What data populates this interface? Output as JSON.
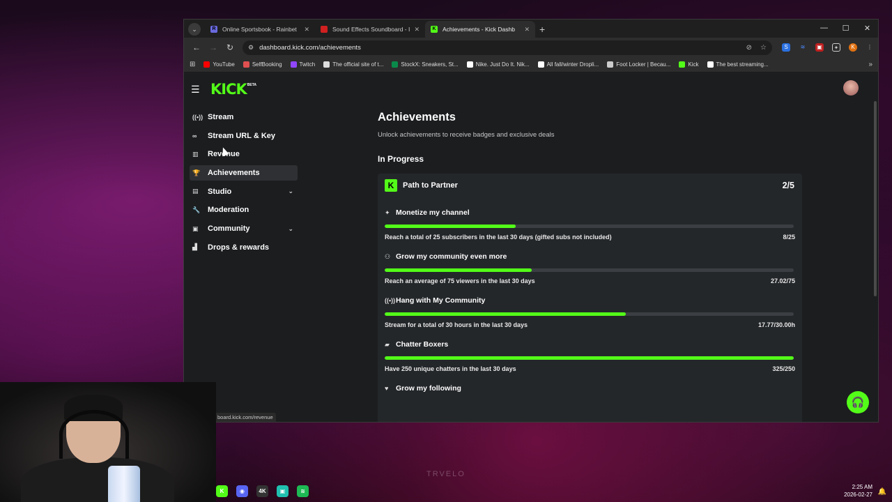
{
  "browser": {
    "tabs": [
      {
        "title": "Online Sportsbook - Rainbet",
        "active": false,
        "favicon_color": "#6a6ae0",
        "glyph": "R"
      },
      {
        "title": "Sound Effects Soundboard - In",
        "active": false,
        "favicon_color": "#d02020",
        "glyph": ""
      },
      {
        "title": "Achievements - Kick Dashb",
        "active": true,
        "favicon_color": "#53fc18",
        "glyph": "K"
      }
    ],
    "new_tab": "+",
    "window_controls": {
      "minimize": "—",
      "maximize": "☐",
      "close": "✕"
    },
    "url": "dashboard.kick.com/achievements",
    "bookmarks": [
      {
        "label": "YouTube",
        "color": "#ff0000"
      },
      {
        "label": "SelfBooking",
        "color": "#e05050"
      },
      {
        "label": "Twitch",
        "color": "#9146ff"
      },
      {
        "label": "The official site of t...",
        "color": "#dddddd"
      },
      {
        "label": "StockX: Sneakers, St...",
        "color": "#0a8a4a"
      },
      {
        "label": "Nike. Just Do It. Nik...",
        "color": "#ffffff"
      },
      {
        "label": "All fall/winter Dropli...",
        "color": "#ffffff"
      },
      {
        "label": "Foot Locker | Becau...",
        "color": "#cccccc"
      },
      {
        "label": "Kick",
        "color": "#53fc18"
      },
      {
        "label": "The best streaming...",
        "color": "#ffffff"
      }
    ],
    "more_bookmarks": "»",
    "status_url": "board.kick.com/revenue"
  },
  "kick": {
    "logo": "KICK",
    "beta": "BETA",
    "sidebar": {
      "items": [
        {
          "label": "Stream",
          "icon": "broadcast-icon",
          "glyph": "((•))",
          "active": false,
          "expandable": false
        },
        {
          "label": "Stream URL & Key",
          "icon": "link-icon",
          "glyph": "∞",
          "active": false,
          "expandable": false
        },
        {
          "label": "Revenue",
          "icon": "chart-icon",
          "glyph": "▥",
          "active": false,
          "expandable": false
        },
        {
          "label": "Achievements",
          "icon": "trophy-icon",
          "glyph": "🏆",
          "active": true,
          "expandable": false
        },
        {
          "label": "Studio",
          "icon": "studio-icon",
          "glyph": "▤",
          "active": false,
          "expandable": true
        },
        {
          "label": "Moderation",
          "icon": "wrench-icon",
          "glyph": "🔧",
          "active": false,
          "expandable": false
        },
        {
          "label": "Community",
          "icon": "community-icon",
          "glyph": "▣",
          "active": false,
          "expandable": true
        },
        {
          "label": "Drops & rewards",
          "icon": "gift-icon",
          "glyph": "▟",
          "active": false,
          "expandable": false
        }
      ]
    },
    "main": {
      "title": "Achievements",
      "subtitle": "Unlock achievements to receive badges and exclusive deals",
      "section": "In Progress",
      "card": {
        "logo": "K",
        "title": "Path to Partner",
        "count": "2/5",
        "achievements": [
          {
            "name": "Monetize my channel",
            "icon": "sparkle-icon",
            "glyph": "✦",
            "desc": "Reach a total of 25 subscribers in the last 30 days (gifted subs not included)",
            "progress_text": "8/25",
            "progress": 0.32
          },
          {
            "name": "Grow my community even more",
            "icon": "people-icon",
            "glyph": "⚇",
            "desc": "Reach an average of 75 viewers in the last 30 days",
            "progress_text": "27.02/75",
            "progress": 0.36
          },
          {
            "name": "Hang with My Community",
            "icon": "broadcast-icon",
            "glyph": "((•))",
            "desc": "Stream for a total of 30 hours in the last 30 days",
            "progress_text": "17.77/30.00h",
            "progress": 0.59
          },
          {
            "name": "Chatter Boxers",
            "icon": "chat-icon",
            "glyph": "▰",
            "desc": "Have 250 unique chatters in the last 30 days",
            "progress_text": "325/250",
            "progress": 1.0
          },
          {
            "name": "Grow my following",
            "icon": "heart-icon",
            "glyph": "♥",
            "desc": "",
            "progress_text": "",
            "progress": 0
          }
        ]
      }
    }
  },
  "taskbar": {
    "time": "2:25 AM",
    "date": "2026-02-27",
    "apps": [
      {
        "name": "kick-taskbar-icon",
        "color": "#53fc18",
        "glyph": "K"
      },
      {
        "name": "discord-taskbar-icon",
        "color": "#5865f2",
        "glyph": "◉"
      },
      {
        "name": "app-4k-taskbar-icon",
        "color": "#333333",
        "glyph": "4K"
      },
      {
        "name": "app-teal-taskbar-icon",
        "color": "#20c0b0",
        "glyph": "▣"
      },
      {
        "name": "spotify-taskbar-icon",
        "color": "#1db954",
        "glyph": "≋"
      }
    ]
  },
  "wallpaper_text": "TRVELO"
}
